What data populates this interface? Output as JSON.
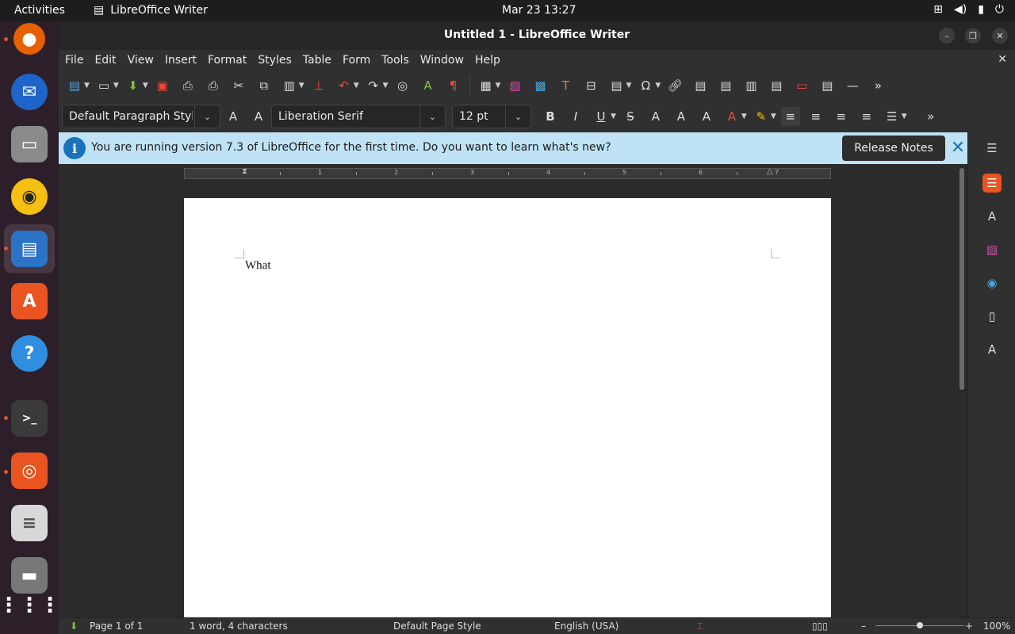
{
  "topbar": {
    "activities": "Activities",
    "app_name": "LibreOffice Writer",
    "clock": "Mar 23  13:27"
  },
  "window": {
    "title": "Untitled 1 - LibreOffice Writer"
  },
  "menubar": {
    "items": [
      "File",
      "Edit",
      "View",
      "Insert",
      "Format",
      "Styles",
      "Table",
      "Form",
      "Tools",
      "Window",
      "Help"
    ]
  },
  "formatting": {
    "paragraph_style": "Default Paragraph Styl",
    "font_name": "Liberation Serif",
    "font_size": "12 pt"
  },
  "infobar": {
    "message": "You are running version 7.3 of LibreOffice for the first time. Do you want to learn what's new?",
    "button_label": "Release Notes"
  },
  "ruler": {
    "numbers": [
      "1",
      "2",
      "3",
      "4",
      "5",
      "6",
      "7"
    ]
  },
  "document": {
    "text": "What"
  },
  "statusbar": {
    "page": "Page 1 of 1",
    "word_count": "1 word, 4 characters",
    "page_style": "Default Page Style",
    "language": "English (USA)",
    "zoom": "100%"
  },
  "colors": {
    "infobar_bg": "#bfe3f5",
    "accent_orange": "#e95420",
    "info_blue": "#1a73b8"
  }
}
